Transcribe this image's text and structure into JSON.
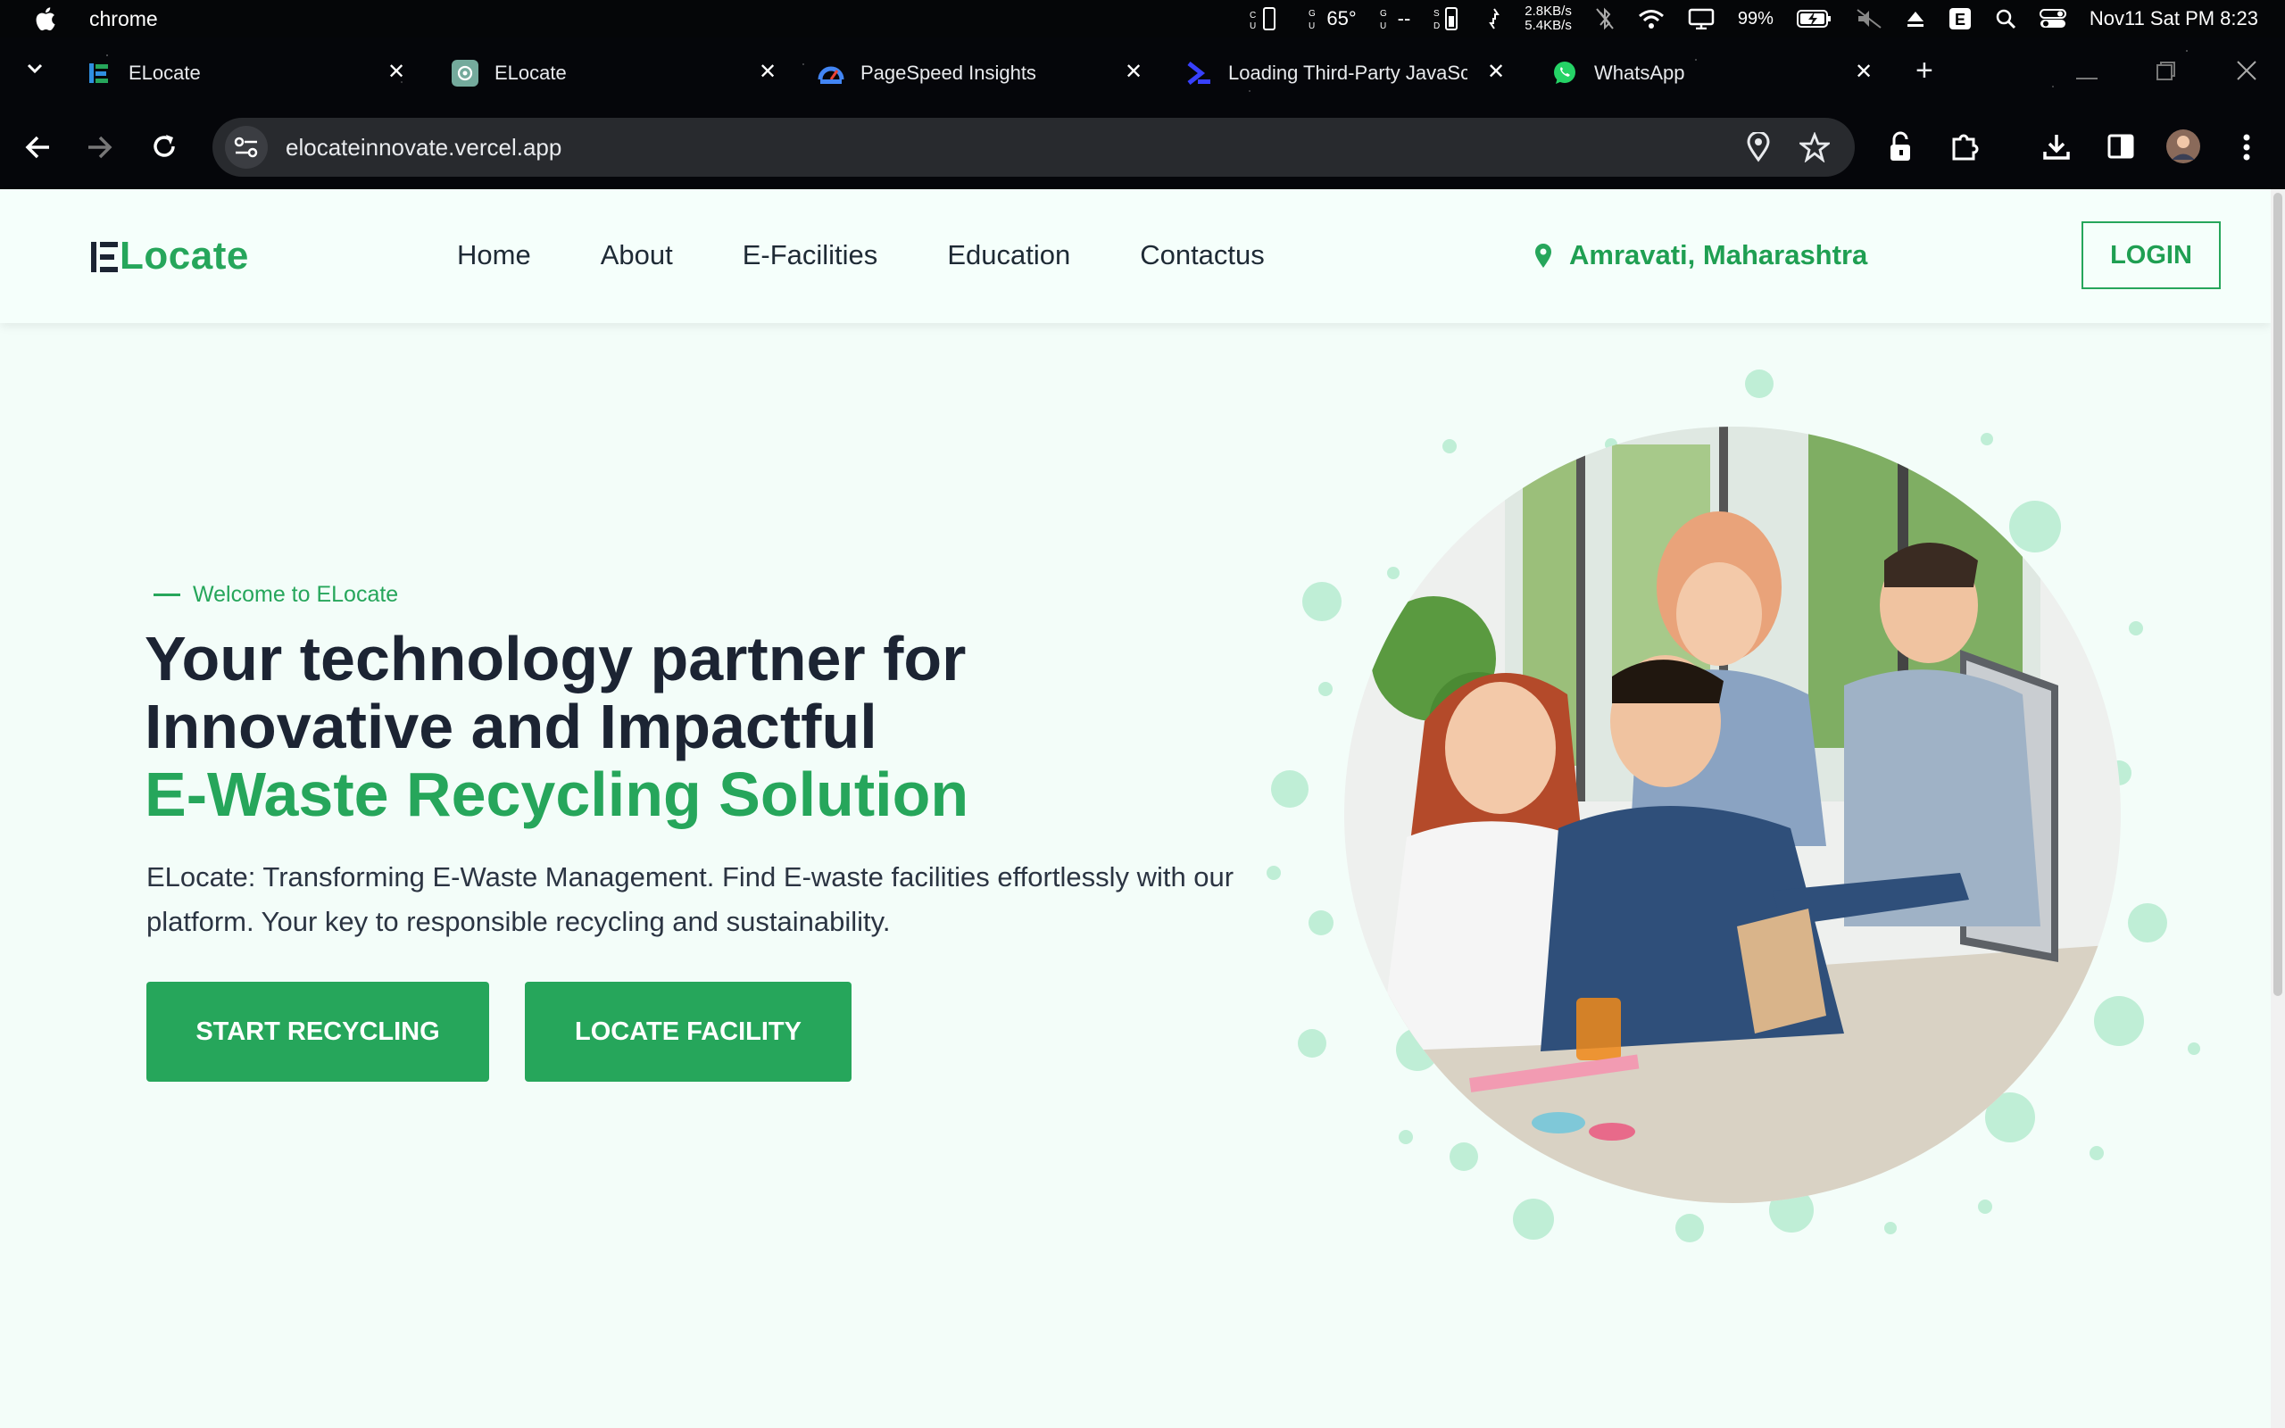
{
  "menubar": {
    "app_name": "chrome",
    "temp": "65°",
    "temp2": "--",
    "net_up": "2.8KB/s",
    "net_down": "5.4KB/s",
    "battery": "99%",
    "datetime": "Nov11 Sat PM 8:23"
  },
  "tabs": [
    {
      "label": "ELocate",
      "icon": "elocate-icon"
    },
    {
      "label": "ELocate",
      "icon": "chatgpt-icon"
    },
    {
      "label": "PageSpeed Insights",
      "icon": "pagespeed-icon"
    },
    {
      "label": "Loading Third-Party JavaScri",
      "icon": "web-dev-icon"
    },
    {
      "label": "WhatsApp",
      "icon": "whatsapp-icon"
    }
  ],
  "address_bar": {
    "url": "elocateinnovate.vercel.app"
  },
  "site": {
    "logo_text": "Locate",
    "nav": [
      "Home",
      "About",
      "E-Facilities",
      "Education",
      "Contactus"
    ],
    "location": "Amravati, Maharashtra",
    "login_label": "LOGIN",
    "welcome": "Welcome to ELocate",
    "headline_line1": "Your technology partner for",
    "headline_line2": "Innovative and Impactful",
    "headline_line3": "E-Waste Recycling Solution",
    "description": "ELocate: Transforming E-Waste Management. Find E-waste facilities effortlessly with our platform. Your key to responsible recycling and sustainability.",
    "cta_primary": "START RECYCLING",
    "cta_secondary": "LOCATE FACILITY"
  },
  "colors": {
    "brand_green": "#26a65b",
    "page_bg": "#f3fdf9",
    "heading_dark": "#1c2433",
    "bubble_green": "#bfeed6"
  }
}
